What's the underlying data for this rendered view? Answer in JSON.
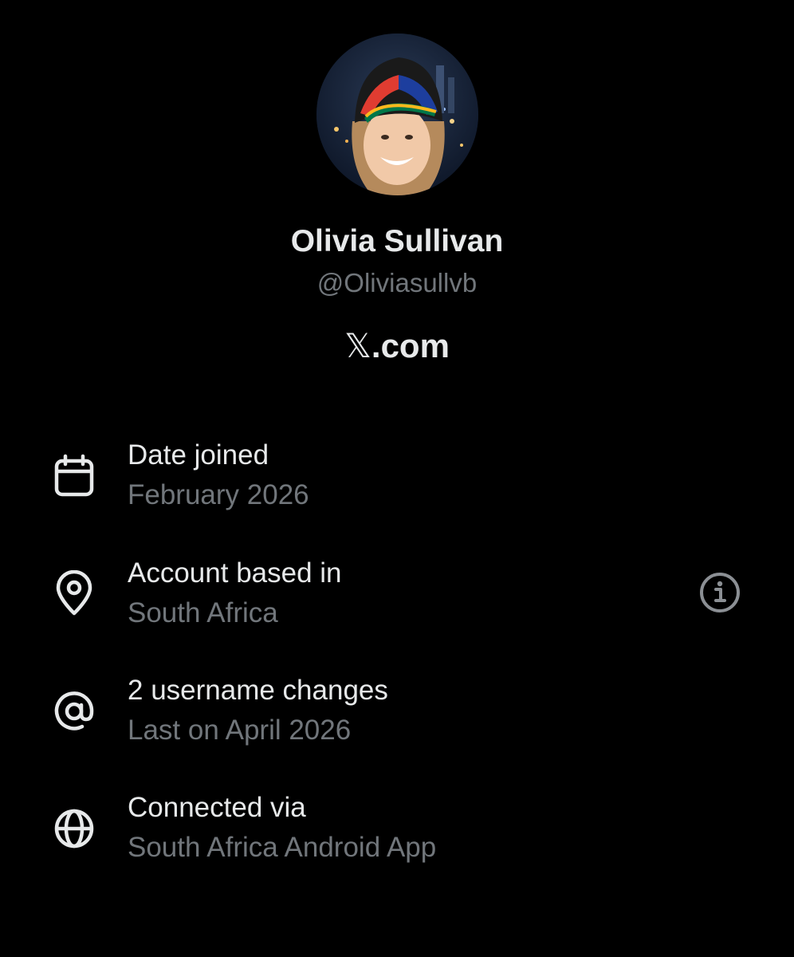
{
  "profile": {
    "display_name": "Olivia Sullivan",
    "handle": "@Oliviasullvb",
    "avatar_desc": "user-avatar"
  },
  "brand": {
    "x_glyph": "𝕏",
    "domain_suffix": ".com"
  },
  "details": [
    {
      "icon": "calendar-icon",
      "title": "Date joined",
      "value": "February 2026"
    },
    {
      "icon": "location-pin-icon",
      "title": "Account based in",
      "value": "South Africa",
      "info_icon": "info-icon"
    },
    {
      "icon": "at-sign-icon",
      "title": "2 username changes",
      "value": "Last on April 2026"
    },
    {
      "icon": "globe-icon",
      "title": "Connected via",
      "value": "South Africa Android App"
    }
  ],
  "colors": {
    "background": "#000000",
    "primary_text": "#e7e9ea",
    "secondary_text": "#71767b",
    "info_icon": "#8b8f94"
  }
}
